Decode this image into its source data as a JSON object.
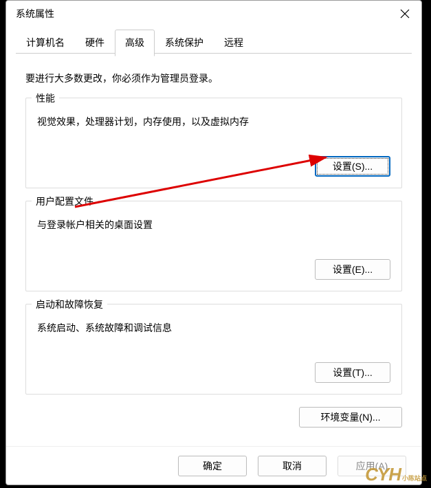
{
  "window": {
    "title": "系统属性"
  },
  "tabs": {
    "computer_name": "计算机名",
    "hardware": "硬件",
    "advanced": "高级",
    "system_protection": "系统保护",
    "remote": "远程"
  },
  "content": {
    "admin_note": "要进行大多数更改，你必须作为管理员登录。",
    "performance": {
      "title": "性能",
      "desc": "视觉效果，处理器计划，内存使用，以及虚拟内存",
      "button": "设置(S)..."
    },
    "user_profiles": {
      "title": "用户配置文件",
      "desc": "与登录帐户相关的桌面设置",
      "button": "设置(E)..."
    },
    "startup_recovery": {
      "title": "启动和故障恢复",
      "desc": "系统启动、系统故障和调试信息",
      "button": "设置(T)..."
    },
    "env_button": "环境变量(N)..."
  },
  "footer": {
    "ok": "确定",
    "cancel": "取消",
    "apply": "应用(A)"
  },
  "watermark": "CYH",
  "watermark_sub": "小陈站点"
}
